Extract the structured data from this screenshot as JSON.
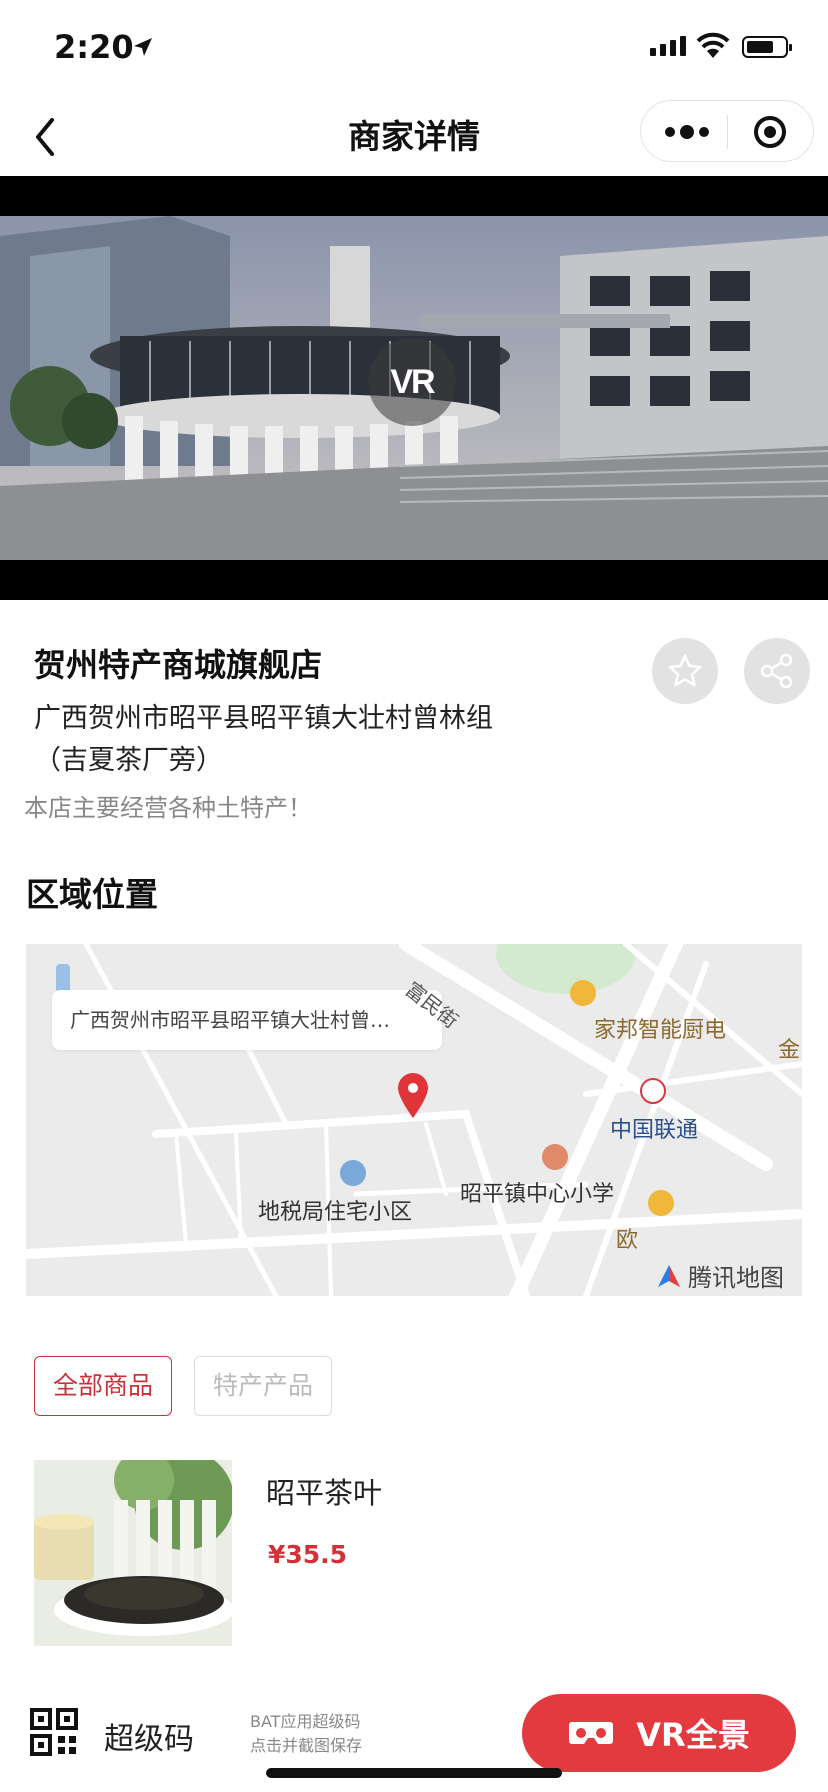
{
  "status_bar": {
    "time": "2:20"
  },
  "nav": {
    "title": "商家详情"
  },
  "hero": {
    "vr_badge": "VR"
  },
  "store": {
    "name": "贺州特产商城旗舰店",
    "address_line1": "广西贺州市昭平县昭平镇大壮村曾林组",
    "address_line2": "（吉夏茶厂旁）",
    "description": "本店主要经营各种土特产！"
  },
  "location": {
    "section_title": "区域位置",
    "map": {
      "address_bubble": "广西贺州市昭平县昭平镇大壮村曾…",
      "street_label": "富民街",
      "pois": {
        "jiabang": "家邦智能厨电",
        "jin": "金",
        "unicom": "中国联通",
        "school": "昭平镇中心小学",
        "tax_housing": "地税局住宅小区",
        "ou": "欧"
      },
      "watermark": "腾讯地图"
    }
  },
  "tabs": [
    {
      "label": "全部商品",
      "active": true
    },
    {
      "label": "特产产品",
      "active": false
    }
  ],
  "products": [
    {
      "name": "昭平茶叶",
      "price": "¥35.5"
    }
  ],
  "bottom_bar": {
    "super_code_label": "超级码",
    "hint_line1": "BAT应用超级码",
    "hint_line2": "点击并截图保存",
    "vr_button": "VR全景"
  },
  "colors": {
    "accent_red": "#e33a3f",
    "price_red": "#d4303a",
    "tab_active": "#c8323a"
  }
}
